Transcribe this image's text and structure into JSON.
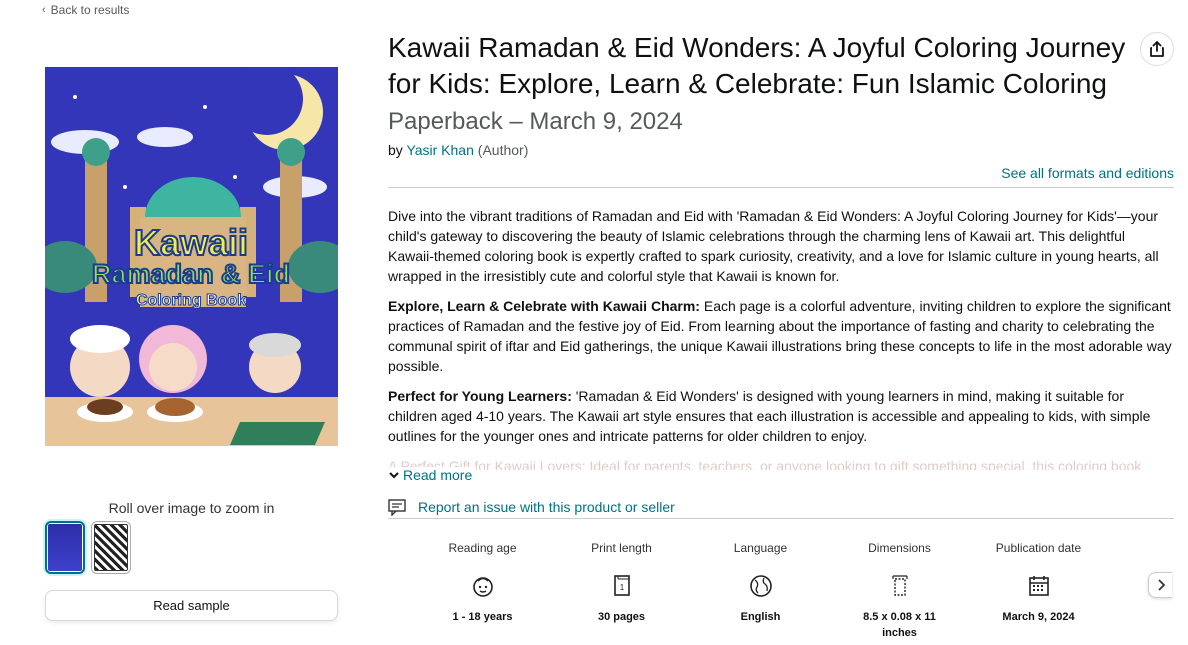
{
  "nav": {
    "back_label": "Back to results"
  },
  "product": {
    "title": "Kawaii Ramadan & Eid Wonders: A Joyful Coloring Journey for Kids: Explore, Learn & Celebrate: Fun Islamic Coloring",
    "format_date": "Paperback – March 9, 2024",
    "by_label": "by",
    "author": "Yasir Khan",
    "author_role": "(Author)",
    "formats_link": "See all formats and editions"
  },
  "cover": {
    "title_line1": "Kawaii",
    "title_line2": "Ramadan & Eid",
    "title_line3": "Coloring Book"
  },
  "gallery": {
    "zoom_hint": "Roll over image to zoom in",
    "read_sample": "Read sample"
  },
  "description": {
    "p1": "Dive into the vibrant traditions of Ramadan and Eid with 'Ramadan & Eid Wonders: A Joyful Coloring Journey for Kids'—your child's gateway to discovering the beauty of Islamic celebrations through the charming lens of Kawaii art. This delightful Kawaii-themed coloring book is expertly crafted to spark curiosity, creativity, and a love for Islamic culture in young hearts, all wrapped in the irresistibly cute and colorful style that Kawaii is known for.",
    "p2_bold": "Explore, Learn & Celebrate with Kawaii Charm:",
    "p2": " Each page is a colorful adventure, inviting children to explore the significant practices of Ramadan and the festive joy of Eid. From learning about the importance of fasting and charity to celebrating the communal spirit of iftar and Eid gatherings, the unique Kawaii illustrations bring these concepts to life in the most adorable way possible.",
    "p3_bold": "Perfect for Young Learners:",
    "p3": " 'Ramadan & Eid Wonders' is designed with young learners in mind, making it suitable for children aged 4-10 years. The Kawaii art style ensures that each illustration is accessible and appealing to kids, with simple outlines for the younger ones and intricate patterns for older children to enjoy.",
    "faded": "A Perfect Gift for Kawaii Lovers: Ideal for parents, teachers, or anyone looking to gift something special, this coloring book",
    "read_more": "Read more"
  },
  "report": {
    "label": "Report an issue with this product or seller"
  },
  "details": [
    {
      "label": "Reading age",
      "icon": "child-face-icon",
      "value": "1 - 18 years"
    },
    {
      "label": "Print length",
      "icon": "page-icon",
      "value": "30 pages"
    },
    {
      "label": "Language",
      "icon": "globe-icon",
      "value": "English"
    },
    {
      "label": "Dimensions",
      "icon": "ruler-icon",
      "value": "8.5 x 0.08 x 11 inches"
    },
    {
      "label": "Publication date",
      "icon": "calendar-icon",
      "value": "March 9, 2024"
    }
  ],
  "colors": {
    "link": "#007185",
    "text": "#0f1111",
    "muted": "#565959"
  }
}
